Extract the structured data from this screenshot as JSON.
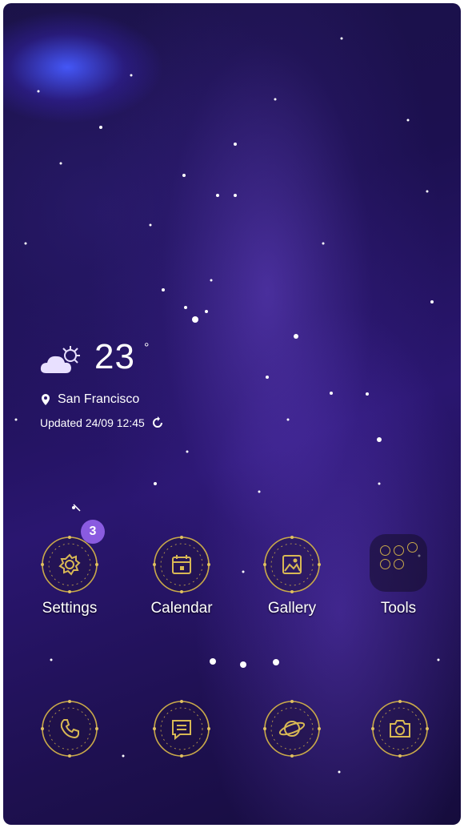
{
  "weather": {
    "temperature": "23",
    "unit": "°",
    "location": "San Francisco",
    "updated": "Updated 24/09 12:45",
    "condition_icon": "partly-cloudy-icon"
  },
  "apps_row1": [
    {
      "label": "Settings",
      "icon": "gear-icon",
      "badge": "3"
    },
    {
      "label": "Calendar",
      "icon": "calendar-icon"
    },
    {
      "label": "Gallery",
      "icon": "image-icon"
    },
    {
      "label": "Tools",
      "icon": "folder-icon"
    }
  ],
  "dock": [
    {
      "icon": "phone-icon"
    },
    {
      "icon": "message-icon"
    },
    {
      "icon": "planet-icon"
    },
    {
      "icon": "camera-icon"
    }
  ],
  "colors": {
    "gold": "#c9a94a",
    "badge": "#8a5be0",
    "text": "#ffffff"
  }
}
